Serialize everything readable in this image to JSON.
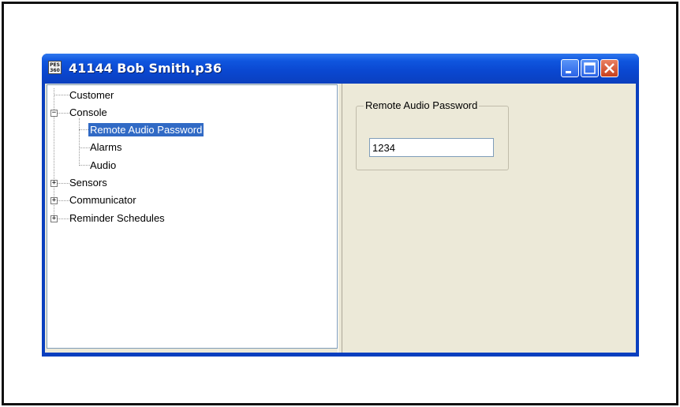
{
  "window": {
    "title": "41144 Bob Smith.p36",
    "app_icon_text": "PES 360"
  },
  "tree": {
    "items": [
      {
        "label": "Customer"
      },
      {
        "label": "Console"
      },
      {
        "label": "Remote Audio Password"
      },
      {
        "label": "Alarms"
      },
      {
        "label": "Audio"
      },
      {
        "label": "Sensors"
      },
      {
        "label": "Communicator"
      },
      {
        "label": "Reminder Schedules"
      }
    ],
    "expanded_symbol": "−",
    "collapsed_symbol": "+"
  },
  "panel": {
    "group_label": "Remote Audio Password",
    "password_value": "1234"
  },
  "colors": {
    "titlebar": "#0a47d0",
    "selection": "#316ac5",
    "client_bg": "#ece9d8"
  }
}
